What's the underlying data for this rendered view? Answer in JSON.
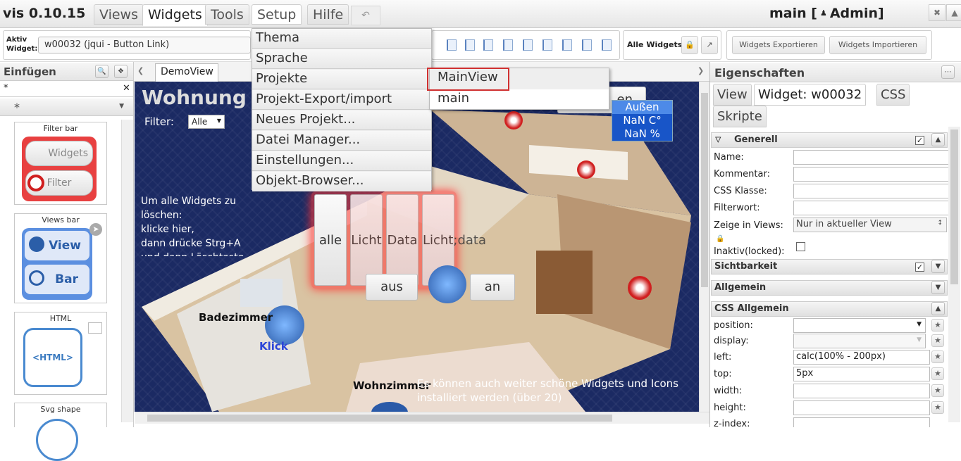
{
  "app": {
    "title": "vis 0.10.15",
    "project_title": "main [",
    "user_icon": "user-icon",
    "user": "Admin]"
  },
  "menu": {
    "tabs": [
      {
        "label": "Views"
      },
      {
        "label": "Widgets"
      },
      {
        "label": "Tools"
      },
      {
        "label": "Setup"
      },
      {
        "label": "Hilfe"
      }
    ],
    "undo": "↶",
    "window_buttons": [
      "✖",
      "▲"
    ]
  },
  "toolbar": {
    "aktiv_label": "Aktiv Widget:",
    "aktiv_value": "w00032 (jqui - Button Link)",
    "alle_widgets_label": "Alle Widgets:",
    "export_label": "Widgets Exportieren",
    "import_label": "Widgets Importieren"
  },
  "left_panel": {
    "title": "Einfügen",
    "filter_value": "*",
    "clear": "✕",
    "type_value": "*",
    "templates": [
      {
        "title": "Filter bar",
        "buttons": [
          "Widgets",
          "Filter"
        ]
      },
      {
        "title": "Views bar",
        "buttons": [
          "View",
          "Bar"
        ]
      },
      {
        "title": "HTML",
        "body": "<HTML>"
      },
      {
        "title": "Svg shape"
      }
    ]
  },
  "view_tabs": {
    "active": "DemoView"
  },
  "canvas": {
    "heading": "Wohnung",
    "filter_label": "Filter:",
    "filter_value": "Alle",
    "delete_hint": [
      "Um alle Widgets zu",
      "löschen:",
      "klicke hier,",
      "dann drücke Strg+A",
      "und dann Löschtaste"
    ],
    "filter_buttons": [
      "alle",
      "Licht",
      "Data",
      "Licht;data"
    ],
    "aus": "aus",
    "an": "an",
    "bad": "Badezimmer",
    "klick": "Klick",
    "wohnzimmer": "Wohnzimmer",
    "kueche": "Küche",
    "info": [
      "Es können auch weiter schöne Widgets und Icons",
      "installiert werden (über 20)"
    ],
    "temp_partial": "en",
    "temps": [
      "Außen",
      "NaN C°",
      "NaN %"
    ]
  },
  "setup_menu": {
    "items": [
      "Thema",
      "Sprache",
      "Projekte",
      "Projekt-Export/import",
      "Neues Projekt...",
      "Datei Manager...",
      "Einstellungen...",
      "Objekt-Browser..."
    ],
    "submenu": [
      "MainView",
      "main"
    ]
  },
  "right_panel": {
    "title": "Eigenschaften",
    "tabs": [
      "View",
      "Widget: w00032",
      "CSS",
      "Skripte"
    ],
    "sections": {
      "generell": "Generell",
      "sichtbarkeit": "Sichtbarkeit",
      "allgemein": "Allgemein",
      "css_allgemein": "CSS Allgemein"
    },
    "generell_props": [
      {
        "label": "Name:",
        "value": ""
      },
      {
        "label": "Kommentar:",
        "value": ""
      },
      {
        "label": "CSS Klasse:",
        "value": ""
      },
      {
        "label": "Filterwort:",
        "value": ""
      }
    ],
    "zeige_label": "Zeige in Views:",
    "zeige_value": "Nur in aktueller View",
    "inaktiv_label": "Inaktiv(locked):",
    "css_props": [
      {
        "label": "position:",
        "value": ""
      },
      {
        "label": "display:",
        "value": ""
      },
      {
        "label": "left:",
        "value": "calc(100% - 200px)"
      },
      {
        "label": "top:",
        "value": "5px"
      },
      {
        "label": "width:",
        "value": ""
      },
      {
        "label": "height:",
        "value": ""
      },
      {
        "label": "z-index:",
        "value": ""
      }
    ]
  }
}
